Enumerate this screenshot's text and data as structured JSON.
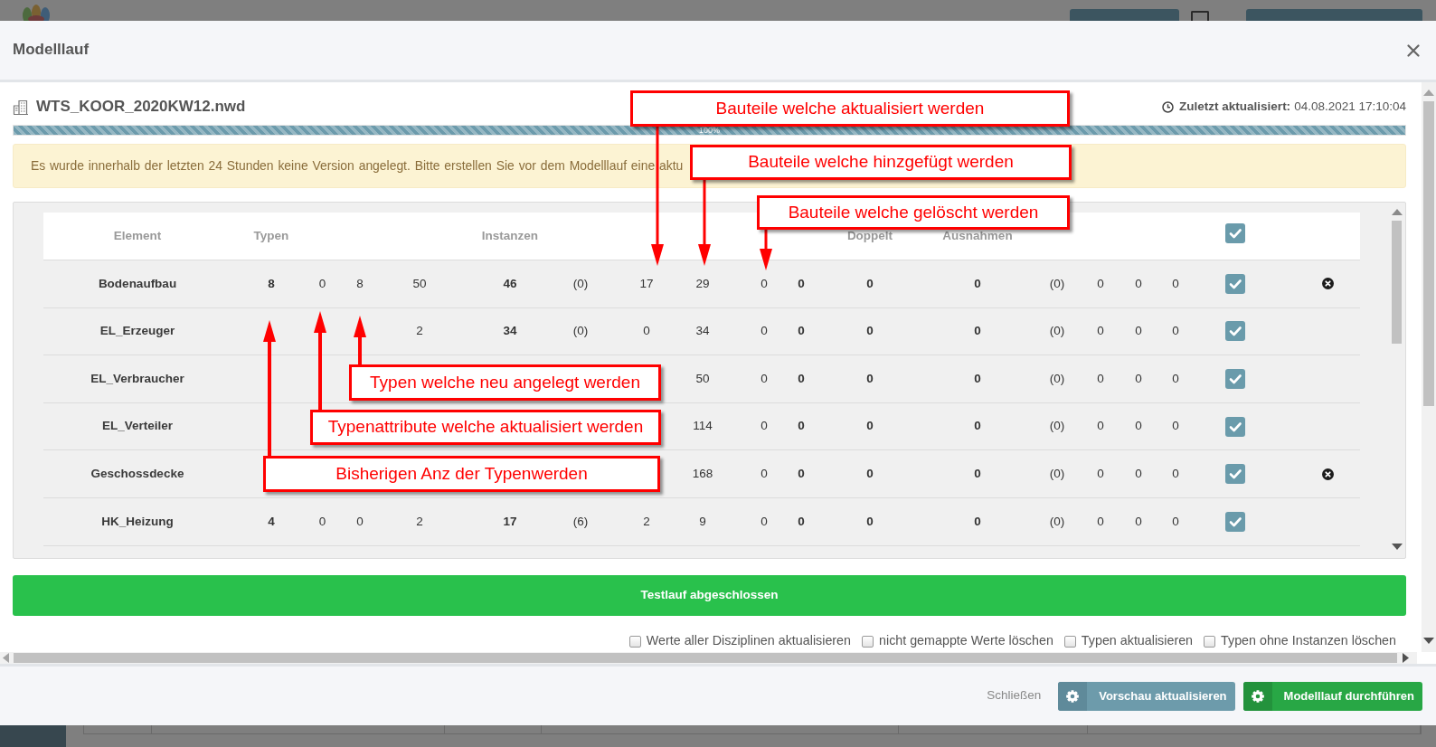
{
  "window": {
    "title": "Modelllauf"
  },
  "file": {
    "name": "WTS_KOOR_2020KW12.nwd",
    "last_updated_label": "Zuletzt aktualisiert:",
    "last_updated": "04.08.2021 17:10:04"
  },
  "progress": {
    "level": 1,
    "label": "100%"
  },
  "warning": "Es wurde innerhalb der letzten 24 Stunden keine Version angelegt. Bitte erstellen Sie vor dem Modelllauf eine aktu",
  "table": {
    "header": [
      {
        "kind": "text",
        "label": "Element"
      },
      {
        "kind": "text",
        "label": "Typen"
      },
      {
        "kind": "text",
        "label": "Instanzen"
      },
      {
        "kind": "text",
        "label": "Doppelt"
      },
      {
        "kind": "text",
        "label": "Ausnahmen"
      },
      {
        "kind": "checkbox",
        "checked": true
      }
    ],
    "rows": [
      {
        "element": "Bodenaufbau",
        "typen": "8",
        "column_3": "0",
        "column_4": "8",
        "column_5": "50",
        "instanzen": "46",
        "column_7": "(0)",
        "column_8": "17",
        "column_9": "29",
        "column_10": "0",
        "column_11": "0",
        "doppelt": "0",
        "ausnahmen": "0",
        "column_14": "(0)",
        "column_15": "0",
        "column_16": "0",
        "column_17": "0",
        "checked": true,
        "removable": true
      },
      {
        "element": "EL_Erzeuger",
        "column_5": "2",
        "instanzen": "34",
        "column_7": "(0)",
        "column_8": "0",
        "column_9": "34",
        "column_10": "0",
        "column_11": "0",
        "doppelt": "0",
        "ausnahmen": "0",
        "column_14": "(0)",
        "column_15": "0",
        "column_16": "0",
        "column_17": "0",
        "checked": true,
        "removable": false
      },
      {
        "element": "EL_Verbraucher",
        "column_9": "50",
        "column_10": "0",
        "column_11": "0",
        "doppelt": "0",
        "ausnahmen": "0",
        "column_14": "(0)",
        "column_15": "0",
        "column_16": "0",
        "column_17": "0",
        "checked": true,
        "removable": false
      },
      {
        "element": "EL_Verteiler",
        "column_9": "114",
        "column_10": "0",
        "column_11": "0",
        "doppelt": "0",
        "ausnahmen": "0",
        "column_14": "(0)",
        "column_15": "0",
        "column_16": "0",
        "column_17": "0",
        "checked": true,
        "removable": false
      },
      {
        "element": "Geschossdecke",
        "column_9": "168",
        "column_10": "0",
        "column_11": "0",
        "doppelt": "0",
        "ausnahmen": "0",
        "column_14": "(0)",
        "column_15": "0",
        "column_16": "0",
        "column_17": "0",
        "checked": true,
        "removable": true
      },
      {
        "element": "HK_Heizung",
        "typen": "4",
        "column_3": "0",
        "column_4": "0",
        "column_5": "2",
        "instanzen": "17",
        "column_7": "(6)",
        "column_8": "2",
        "column_9": "9",
        "column_10": "0",
        "column_11": "0",
        "doppelt": "0",
        "ausnahmen": "0",
        "column_14": "(0)",
        "column_15": "0",
        "column_16": "0",
        "column_17": "0",
        "checked": true,
        "removable": false
      }
    ]
  },
  "status": "Testlauf abgeschlossen",
  "options": [
    {
      "label": "Werte aller Disziplinen aktualisieren",
      "checked": false
    },
    {
      "label": "nicht gemappte Werte löschen",
      "checked": false
    },
    {
      "label": "Typen aktualisieren",
      "checked": false
    },
    {
      "label": "Typen ohne Instanzen löschen",
      "checked": false
    }
  ],
  "buttons": [
    {
      "kind": "link",
      "label": "Schließen"
    },
    {
      "kind": "secondary",
      "label": "Vorschau aktualisieren"
    },
    {
      "kind": "primary",
      "label": "Modelllauf durchführen"
    }
  ],
  "annotations": [
    {
      "text": "Bauteile welche aktualisiert werden",
      "kind": "down"
    },
    {
      "text": "Bauteile welche hinzgefügt werden",
      "kind": "down"
    },
    {
      "text": "Bauteile welche gelöscht werden",
      "kind": "down"
    },
    {
      "text": "Typen welche neu angelegt werden",
      "kind": "up"
    },
    {
      "text": "Typenattribute welche aktualisiert werden",
      "kind": "up"
    },
    {
      "text": "Bisherigen Anz der Typenwerden",
      "kind": "up"
    }
  ]
}
